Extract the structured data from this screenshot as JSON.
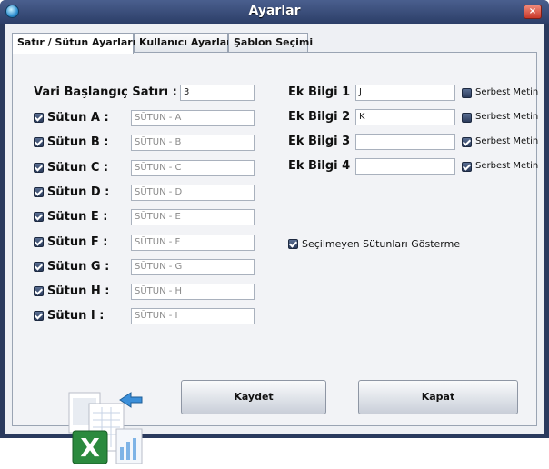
{
  "window": {
    "title": "Ayarlar",
    "close_glyph": "×"
  },
  "tabs": [
    {
      "label": "Satır / Sütun Ayarları"
    },
    {
      "label": "Kullanıcı Ayarları"
    },
    {
      "label": "Şablon Seçimi"
    }
  ],
  "start_row": {
    "label": "Vari Başlangıç Satırı :",
    "value": "3"
  },
  "columns": [
    {
      "label": "Sütun A :",
      "placeholder": "SÜTUN - A",
      "checked": true
    },
    {
      "label": "Sütun B :",
      "placeholder": "SÜTUN - B",
      "checked": true
    },
    {
      "label": "Sütun C :",
      "placeholder": "SÜTUN - C",
      "checked": true
    },
    {
      "label": "Sütun D :",
      "placeholder": "SÜTUN - D",
      "checked": true
    },
    {
      "label": "Sütun E :",
      "placeholder": "SÜTUN - E",
      "checked": true
    },
    {
      "label": "Sütun F :",
      "placeholder": "SÜTUN - F",
      "checked": true
    },
    {
      "label": "Sütun G :",
      "placeholder": "SÜTUN - G",
      "checked": true
    },
    {
      "label": "Sütun H :",
      "placeholder": "SÜTUN - H",
      "checked": true
    },
    {
      "label": "Sütun I :",
      "placeholder": "SÜTUN - I",
      "checked": true
    }
  ],
  "extra_info": [
    {
      "label": "Ek Bilgi 1 :",
      "value": "J",
      "option": "Serbest Metin",
      "checked": false
    },
    {
      "label": "Ek Bilgi 2 :",
      "value": "K",
      "option": "Serbest Metin",
      "checked": false
    },
    {
      "label": "Ek Bilgi 3 :",
      "value": "",
      "option": "Serbest Metin",
      "checked": true
    },
    {
      "label": "Ek Bilgi 4 :",
      "value": "",
      "option": "Serbest Metin",
      "checked": true
    }
  ],
  "hide_unselected": {
    "label": "Seçilmeyen Sütunları Gösterme",
    "checked": true
  },
  "buttons": {
    "save": "Kaydet",
    "close": "Kapat"
  },
  "icons": {
    "app": "app-globe-icon",
    "excel": "excel-file-icon",
    "close": "close-icon"
  }
}
